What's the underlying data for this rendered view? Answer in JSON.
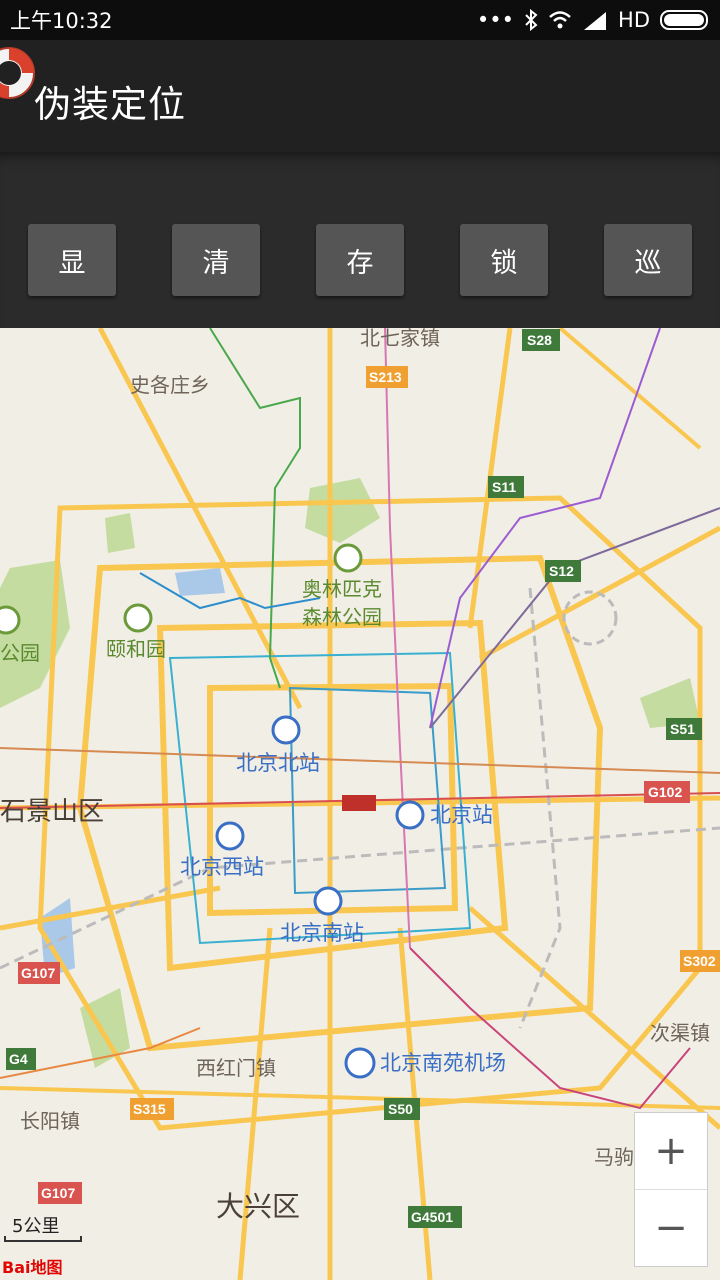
{
  "status_bar": {
    "time": "上午10:32",
    "icons": [
      "more-dots-icon",
      "bluetooth-icon",
      "wifi-icon",
      "signal-icon",
      "battery-icon"
    ],
    "network_label": "HD"
  },
  "app": {
    "title": "伪装定位",
    "icon": "lifebuoy-icon"
  },
  "toolbar": {
    "buttons": [
      {
        "label": "显"
      },
      {
        "label": "清"
      },
      {
        "label": "存"
      },
      {
        "label": "锁"
      },
      {
        "label": "巡"
      }
    ]
  },
  "map": {
    "labels": {
      "beiqijia": "北七家镇",
      "shigezhuang": "史各庄乡",
      "olympic_line1": "奥林匹克",
      "olympic_line2": "森林公园",
      "yiheyuan": "颐和园",
      "park_left": "公园",
      "beijing_north": "北京北站",
      "shijingshan": "石景山区",
      "beijing_station": "北京站",
      "beijing_west": "北京西站",
      "beijing_south": "北京南站",
      "cijuzhen": "次渠镇",
      "xihongmen": "西红门镇",
      "nanyuan_airport": "北京南苑机场",
      "changyang": "长阳镇",
      "maju": "马驹",
      "daxing": "大兴区"
    },
    "road_shields": {
      "s28": "S28",
      "s213": "S213",
      "s11": "S11",
      "s12": "S12",
      "s51": "S51",
      "g102": "G102",
      "s302": "S302",
      "g107a": "G107",
      "g4": "G4",
      "s315": "S315",
      "s50": "S50",
      "g107b": "G107",
      "g4501": "G4501"
    },
    "zoom_in": "+",
    "zoom_out": "−",
    "scale_label": "5公里",
    "logo_text": "Bai地图"
  },
  "colors": {
    "status_bar": "#0d0d0d",
    "action_bar": "#212121",
    "toolbar": "#2b2b2b",
    "button": "#555555",
    "map_bg": "#f1eee6",
    "road": "#f9c74f",
    "label_blue": "#3a6fc6",
    "label_green": "#5b8a2e"
  }
}
